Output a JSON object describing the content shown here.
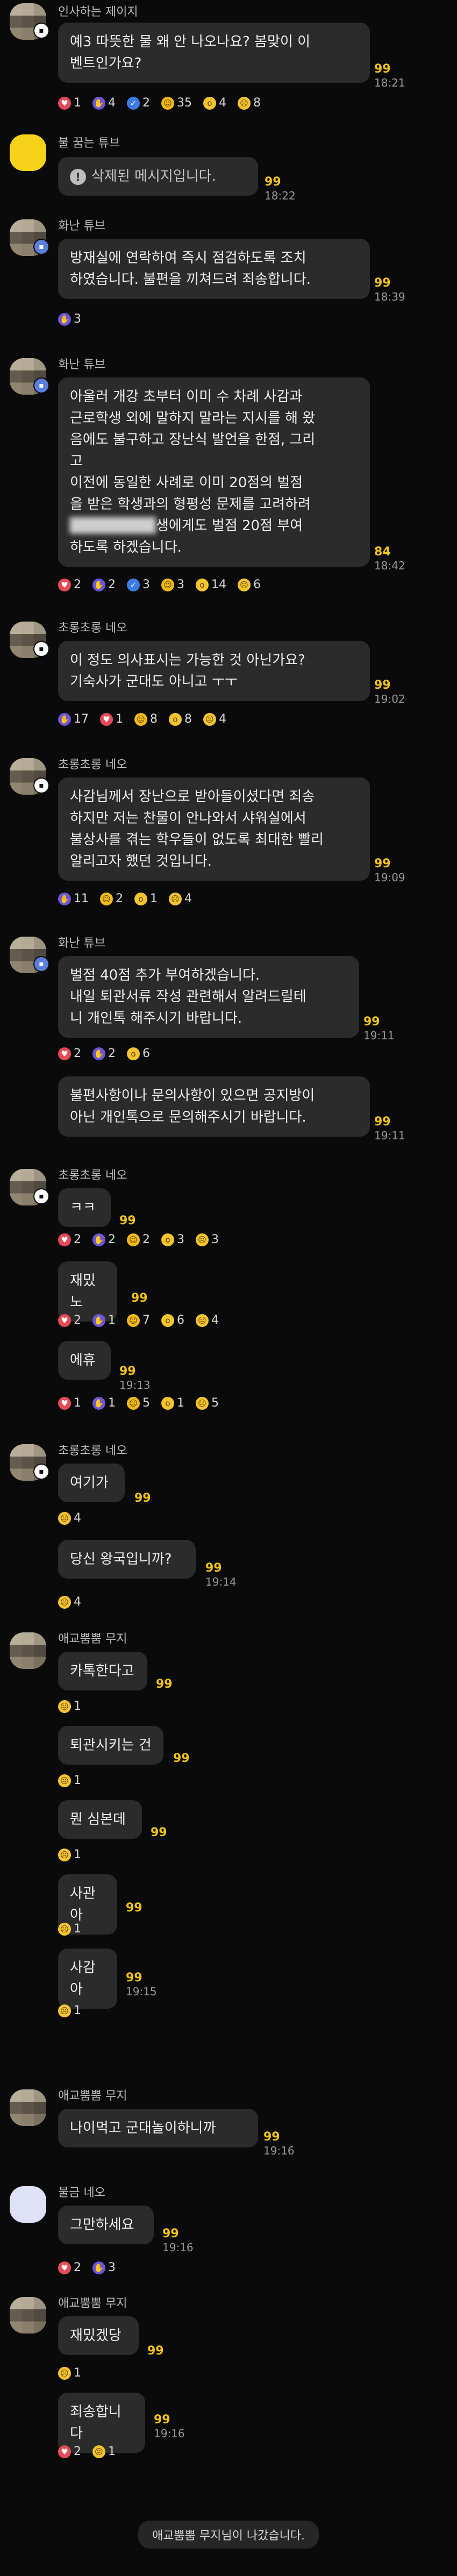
{
  "messages": [
    {
      "sender": "인사하는 제이지",
      "lines": [
        "예3 따뜻한 물 왜 안 나오나요? 봄맞이 이",
        "벤트인가요?"
      ],
      "unread": "99",
      "time": "18:21",
      "reactions": [
        {
          "icon": "heart",
          "count": "1"
        },
        {
          "icon": "thumb",
          "count": "4"
        },
        {
          "icon": "check",
          "count": "2"
        },
        {
          "icon": "smile",
          "count": "35"
        },
        {
          "icon": "wow",
          "count": "4"
        },
        {
          "icon": "sad",
          "count": "8"
        }
      ]
    },
    {
      "sender": "불 꿈는 튜브",
      "deleted": "삭제된 메시지입니다.",
      "unread": "99",
      "time": "18:22"
    },
    {
      "sender": "화난 튜브",
      "lines": [
        "방재실에 연락하여 즉시 점검하도록 조치",
        "하였습니다. 불편을 끼쳐드려 죄송합니다."
      ],
      "unread": "99",
      "time": "18:39",
      "reactions": [
        {
          "icon": "thumb",
          "count": "3"
        }
      ]
    },
    {
      "sender": "화난 튜브",
      "lines": [
        "아울러 개강 초부터 이미 수 차례 사감과",
        "근로학생 외에 말하지 말라는 지시를 해 왔",
        "음에도 불구하고 장난식 발언을 한점, 그리",
        "고",
        " 이전에 동일한 사례로 이미 20점의 벌점",
        "을 받은 학생과의 형평성 문제를 고려하려",
        "생에게도 벌점 20점 부여",
        "하도록 하겠습니다."
      ],
      "unread": "84",
      "time": "18:42",
      "reactions": [
        {
          "icon": "heart",
          "count": "2"
        },
        {
          "icon": "thumb",
          "count": "2"
        },
        {
          "icon": "check",
          "count": "3"
        },
        {
          "icon": "smile",
          "count": "3"
        },
        {
          "icon": "wow",
          "count": "14"
        },
        {
          "icon": "sad",
          "count": "6"
        }
      ]
    },
    {
      "sender": "초롱초롱 네오",
      "lines": [
        "이 정도 의사표시는 가능한 것 아닌가요?",
        "기숙사가 군대도 아니고 ㅜㅜ"
      ],
      "unread": "99",
      "time": "19:02",
      "reactions": [
        {
          "icon": "thumb",
          "count": "17"
        },
        {
          "icon": "heart",
          "count": "1"
        },
        {
          "icon": "smile",
          "count": "8"
        },
        {
          "icon": "wow",
          "count": "8"
        },
        {
          "icon": "sad",
          "count": "4"
        }
      ]
    },
    {
      "sender": "초롱초롱 네오",
      "lines": [
        "사감님께서 장난으로 받아들이셨다면 죄송",
        "하지만 저는 찬물이 안나와서 샤워실에서",
        "불상사를 겪는 학우들이 없도록 최대한 빨리",
        "알리고자 했던 것입니다."
      ],
      "unread": "99",
      "time": "19:09",
      "reactions": [
        {
          "icon": "thumb",
          "count": "11"
        },
        {
          "icon": "smile",
          "count": "2"
        },
        {
          "icon": "wow",
          "count": "1"
        },
        {
          "icon": "sad",
          "count": "4"
        }
      ]
    },
    {
      "sender": "화난 튜브",
      "lines": [
        "벌점 40점 추가 부여하겠습니다.",
        "내일 퇴관서류 작성 관련해서 알려드릴테",
        "니 개인톡 해주시기 바랍니다."
      ],
      "unread": "99",
      "time": "19:11",
      "reactions": [
        {
          "icon": "heart",
          "count": "2"
        },
        {
          "icon": "thumb",
          "count": "2"
        },
        {
          "icon": "wow",
          "count": "6"
        }
      ]
    },
    {
      "lines": [
        "불편사항이나 문의사항이 있으면 공지방이",
        "아닌 개인톡으로 문의해주시기 바랍니다."
      ],
      "unread": "99",
      "time": "19:11"
    },
    {
      "sender": "초롱초롱 네오",
      "lines": [
        "ㅋㅋ"
      ],
      "unread": "99",
      "reactions": [
        {
          "icon": "heart",
          "count": "2"
        },
        {
          "icon": "thumb",
          "count": "2"
        },
        {
          "icon": "smile",
          "count": "2"
        },
        {
          "icon": "wow",
          "count": "3"
        },
        {
          "icon": "sad",
          "count": "3"
        }
      ]
    },
    {
      "lines": [
        "재밌노"
      ],
      "unread": "99",
      "reactions": [
        {
          "icon": "heart",
          "count": "2"
        },
        {
          "icon": "thumb",
          "count": "1"
        },
        {
          "icon": "smile",
          "count": "7"
        },
        {
          "icon": "wow",
          "count": "6"
        },
        {
          "icon": "sad",
          "count": "4"
        }
      ]
    },
    {
      "lines": [
        "에휴"
      ],
      "unread": "99",
      "time": "19:13",
      "reactions": [
        {
          "icon": "heart",
          "count": "1"
        },
        {
          "icon": "thumb",
          "count": "1"
        },
        {
          "icon": "smile",
          "count": "5"
        },
        {
          "icon": "wow",
          "count": "1"
        },
        {
          "icon": "sad",
          "count": "5"
        }
      ]
    },
    {
      "sender": "초롱초롱 네오",
      "lines": [
        "여기가"
      ],
      "unread": "99",
      "reactions": [
        {
          "icon": "sad",
          "count": "4"
        }
      ]
    },
    {
      "lines": [
        "당신 왕국입니까?"
      ],
      "unread": "99",
      "time": "19:14",
      "reactions": [
        {
          "icon": "sad",
          "count": "4"
        }
      ]
    },
    {
      "sender": "애교뿜뿜 무지",
      "lines": [
        "카톡한다고"
      ],
      "unread": "99",
      "reactions": [
        {
          "icon": "sad",
          "count": "1"
        }
      ]
    },
    {
      "lines": [
        "퇴관시키는 건"
      ],
      "unread": "99",
      "reactions": [
        {
          "icon": "sad",
          "count": "1"
        }
      ]
    },
    {
      "lines": [
        "뭔 심본데"
      ],
      "unread": "99",
      "reactions": [
        {
          "icon": "sad",
          "count": "1"
        }
      ]
    },
    {
      "lines": [
        "사관아"
      ],
      "unread": "99",
      "reactions": [
        {
          "icon": "sad",
          "count": "1"
        }
      ]
    },
    {
      "lines": [
        "사감아"
      ],
      "unread": "99",
      "time": "19:15",
      "reactions": [
        {
          "icon": "sad",
          "count": "1"
        }
      ]
    },
    {
      "sender": "애교뿜뿜 무지",
      "lines": [
        "나이먹고 군대놀이하니까"
      ],
      "unread": "99",
      "time": "19:16"
    },
    {
      "sender": "불금 네오",
      "lines": [
        "그만하세요"
      ],
      "unread": "99",
      "time": "19:16",
      "reactions": [
        {
          "icon": "heart",
          "count": "2"
        },
        {
          "icon": "thumb",
          "count": "3"
        }
      ]
    },
    {
      "sender": "애교뿜뿜 무지",
      "lines": [
        "재밌겠당"
      ],
      "unread": "99",
      "reactions": [
        {
          "icon": "sad",
          "count": "1"
        }
      ]
    },
    {
      "lines": [
        "죄송합니다"
      ],
      "unread": "99",
      "time": "19:16",
      "reactions": [
        {
          "icon": "heart",
          "count": "2"
        },
        {
          "icon": "sad",
          "count": "1"
        }
      ]
    }
  ],
  "system": {
    "left_notice": "애교뿜뿜 무지님이 나갔습니다."
  },
  "icons": {
    "heart": "♥",
    "thumb": "👍",
    "check": "✓",
    "smile": "😆",
    "wow": "😮",
    "sad": "😢",
    "clap": "👏"
  },
  "colors": {
    "bg": "#0a0a0a",
    "bubble": "#2b2b2b",
    "unread": "#f0c419"
  }
}
